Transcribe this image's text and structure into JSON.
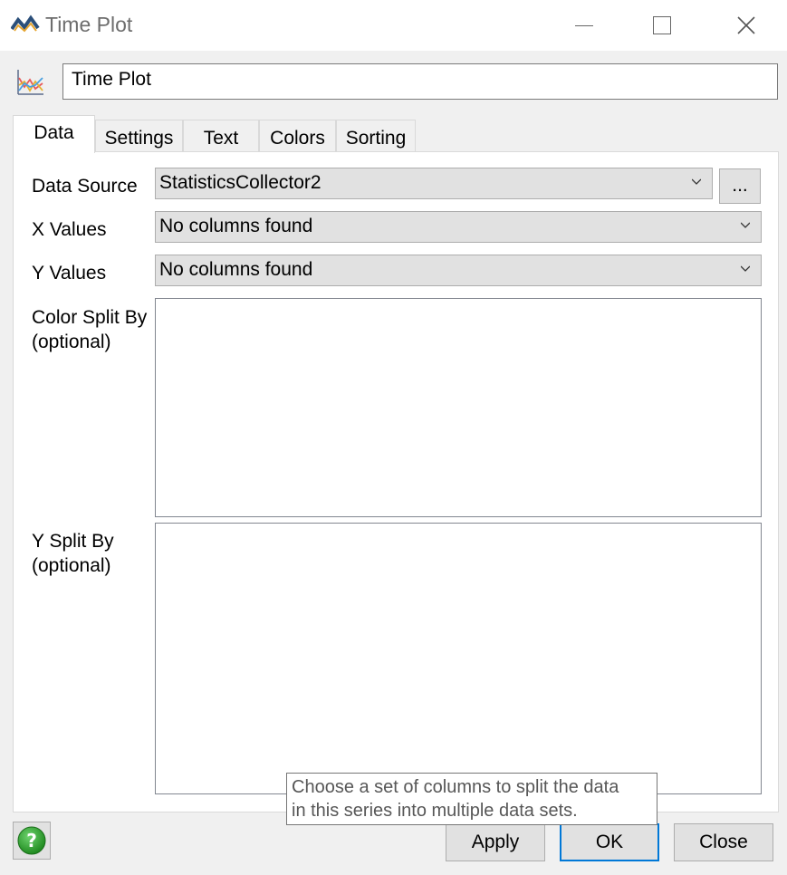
{
  "window": {
    "title": "Time Plot",
    "icon": "flexsim-logo-icon",
    "controls": {
      "minimize": "minimize-icon",
      "maximize": "maximize-icon",
      "close": "close-icon"
    }
  },
  "header": {
    "icon": "time-plot-chart-icon",
    "name_value": "Time Plot"
  },
  "tabs": [
    {
      "label": "Data",
      "active": true
    },
    {
      "label": "Settings",
      "active": false
    },
    {
      "label": "Text",
      "active": false
    },
    {
      "label": "Colors",
      "active": false
    },
    {
      "label": "Sorting",
      "active": false
    }
  ],
  "form": {
    "data_source": {
      "label": "Data Source",
      "value": "StatisticsCollector2",
      "browse_label": "..."
    },
    "x_values": {
      "label": "X Values",
      "value": "No columns found"
    },
    "y_values": {
      "label": "Y Values",
      "value": "No columns found"
    },
    "color_split": {
      "label_line1": "Color Split By",
      "label_line2": "(optional)"
    },
    "y_split": {
      "label_line1": "Y Split By",
      "label_line2": "(optional)"
    }
  },
  "tooltip": {
    "line1": "Choose a set of columns to split the data",
    "line2": "in this series into multiple data sets."
  },
  "footer": {
    "help_icon": "help-question-icon",
    "apply_label": "Apply",
    "ok_label": "OK",
    "close_label": "Close"
  },
  "colors": {
    "accent": "#0078d7",
    "help_green": "#2e9e2e"
  }
}
